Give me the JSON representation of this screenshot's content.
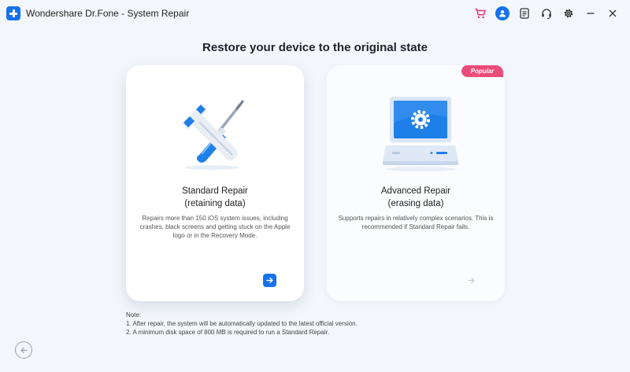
{
  "window": {
    "title": "Wondershare Dr.Fone - System Repair",
    "toolbar_icons": [
      "cart-icon",
      "account-icon",
      "feedback-icon",
      "support-icon",
      "settings-icon",
      "minimize-icon",
      "close-icon"
    ]
  },
  "page": {
    "heading": "Restore your device to the original state"
  },
  "cards": [
    {
      "title": "Standard Repair",
      "subtitle": "(retaining data)",
      "description": "Repairs more than 150 iOS system issues, including crashes, black screens and getting stuck on the Apple logo or in the Recovery Mode.",
      "selected": true
    },
    {
      "title": "Advanced Repair",
      "subtitle": "(erasing data)",
      "description": "Supports repairs in relatively complex scenarios. This is recommended if Standard Repair fails.",
      "badge": "Popular",
      "selected": false
    }
  ],
  "notes": {
    "label": "Note:",
    "lines": [
      "1. After repair, the system will be automatically updated to the latest official version.",
      "2. A minimum disk space of 800 MB is required to run a Standard Repair."
    ]
  },
  "colors": {
    "accent": "#1672ec",
    "badge": "#ec4c7a",
    "cart": "#e0307a",
    "background": "#f3f6fa"
  }
}
